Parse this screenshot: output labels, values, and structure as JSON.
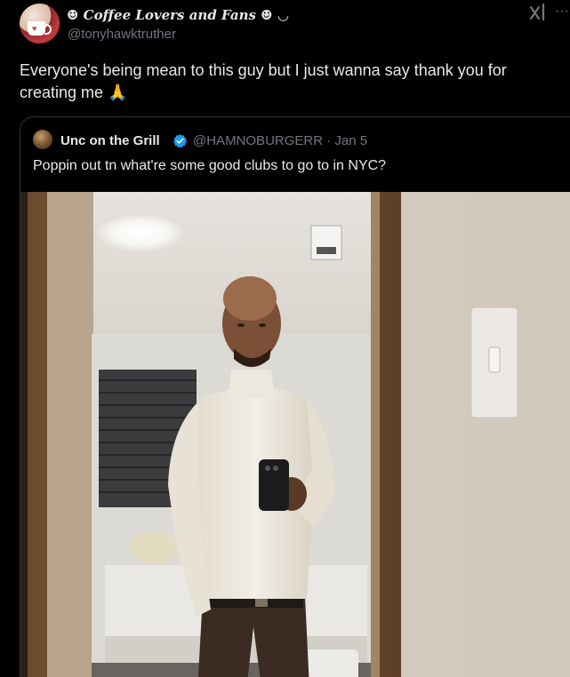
{
  "tweet": {
    "display_name": "☻ Coffee Lovers and Fans ☻ ◡",
    "handle": "@tonyhawktruther",
    "text": "Everyone's being mean to this guy but I just wanna say thank you for creating me 🙏",
    "avatar_icon": "coffee-mug-icon",
    "more_label": "···"
  },
  "quote": {
    "name": "Unc on the Grill",
    "handle_date": "@HAMNOBURGERR · Jan 5",
    "text": "Poppin out tn what're some good clubs to go to in NYC?",
    "verified_color": "#1d9bf0"
  },
  "colors": {
    "background": "#000000",
    "text": "#e7e9ea",
    "secondary": "#71767b",
    "border": "#2f3336"
  }
}
